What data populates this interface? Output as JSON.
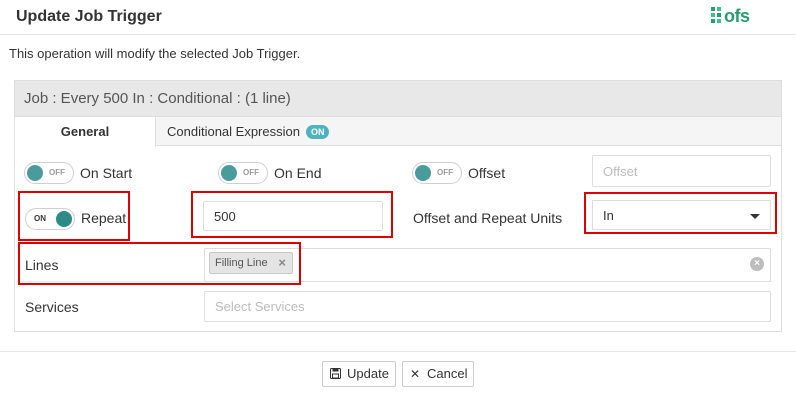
{
  "dialog": {
    "title": "Update Job Trigger",
    "logo_text": "ofs",
    "info": "This operation will modify the selected Job Trigger."
  },
  "panel": {
    "heading": "Job : Every 500 In : Conditional : (1 line)",
    "tabs": [
      {
        "label": "General",
        "active": true
      },
      {
        "label": "Conditional Expression",
        "badge": "ON"
      }
    ]
  },
  "toggles": {
    "on_start": {
      "state": "OFF",
      "label": "On Start"
    },
    "on_end": {
      "state": "OFF",
      "label": "On End"
    },
    "offset": {
      "state": "OFF",
      "label": "Offset"
    },
    "repeat": {
      "state": "ON",
      "label": "Repeat"
    }
  },
  "fields": {
    "offset_placeholder": "Offset",
    "repeat_value": "500",
    "units_label": "Offset and Repeat Units",
    "units_value": "In",
    "lines_label": "Lines",
    "lines_tag": "Filling Line",
    "services_label": "Services",
    "services_placeholder": "Select Services"
  },
  "buttons": {
    "update": "Update",
    "cancel": "Cancel"
  },
  "colors": {
    "accent": "#4a9c9c",
    "badge": "#4fb3bf",
    "highlight": "#dd0000",
    "logo": "#2a9d6e"
  }
}
